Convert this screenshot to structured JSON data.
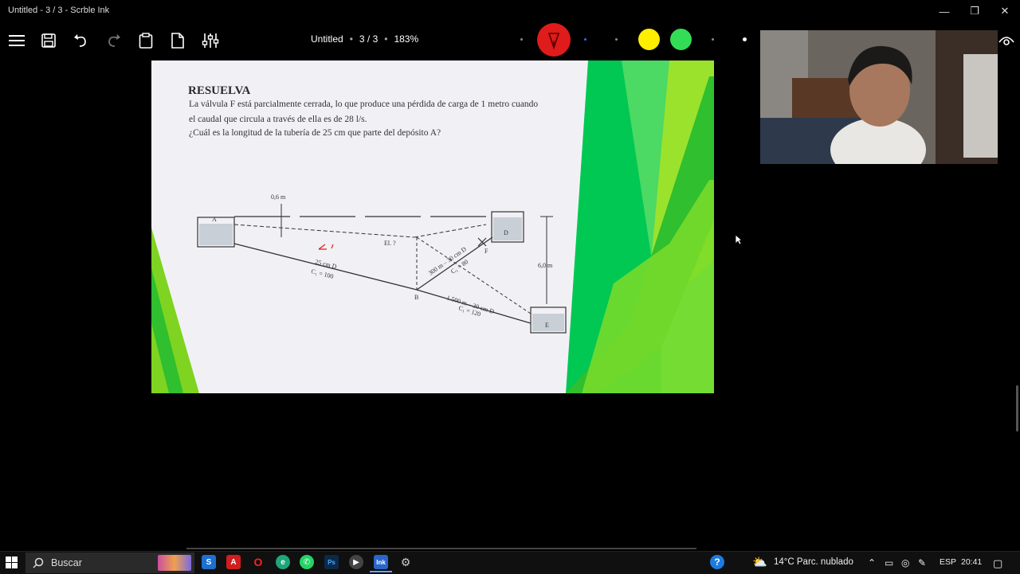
{
  "window": {
    "title": "Untitled - 3 / 3 - Scrble Ink"
  },
  "toolbar": {
    "doc_name": "Untitled",
    "page_info": "3 / 3",
    "zoom": "183%",
    "pen_colors": [
      "#e02020",
      "#ffee00",
      "#33dd55"
    ],
    "icons": [
      "menu-icon",
      "save-icon",
      "undo-icon",
      "redo-icon",
      "paste-icon",
      "page-icon",
      "settings-sliders-icon"
    ]
  },
  "slide": {
    "heading": "RESUELVA",
    "text_lines": [
      "La válvula F está parcialmente cerrada, lo que produce una pérdida de carga de 1 metro cuando",
      "el caudal que circula a través de ella es de 28 l/s.",
      "¿Cuál es la longitud de la tubería de 25 cm que parte del depósito A?"
    ],
    "diagram": {
      "labels": {
        "a": "A",
        "d": "D",
        "e": "E",
        "b": "B",
        "f": "F",
        "h06": "0,6 m",
        "h6": "6,0 m",
        "el": "El. ?",
        "pipe1a": "25 cm D",
        "pipe1b": "C₁ = 100",
        "pipe2a": "300 m – 30 cm D",
        "pipe2b": "C₁ = 80",
        "pipe3a": "1.500 m – 30 cm D",
        "pipe3b": "C₁ = 120"
      }
    }
  },
  "taskbar": {
    "search_placeholder": "Buscar",
    "weather": "14°C  Parc. nublado",
    "language": "ESP",
    "time": "20:41"
  }
}
